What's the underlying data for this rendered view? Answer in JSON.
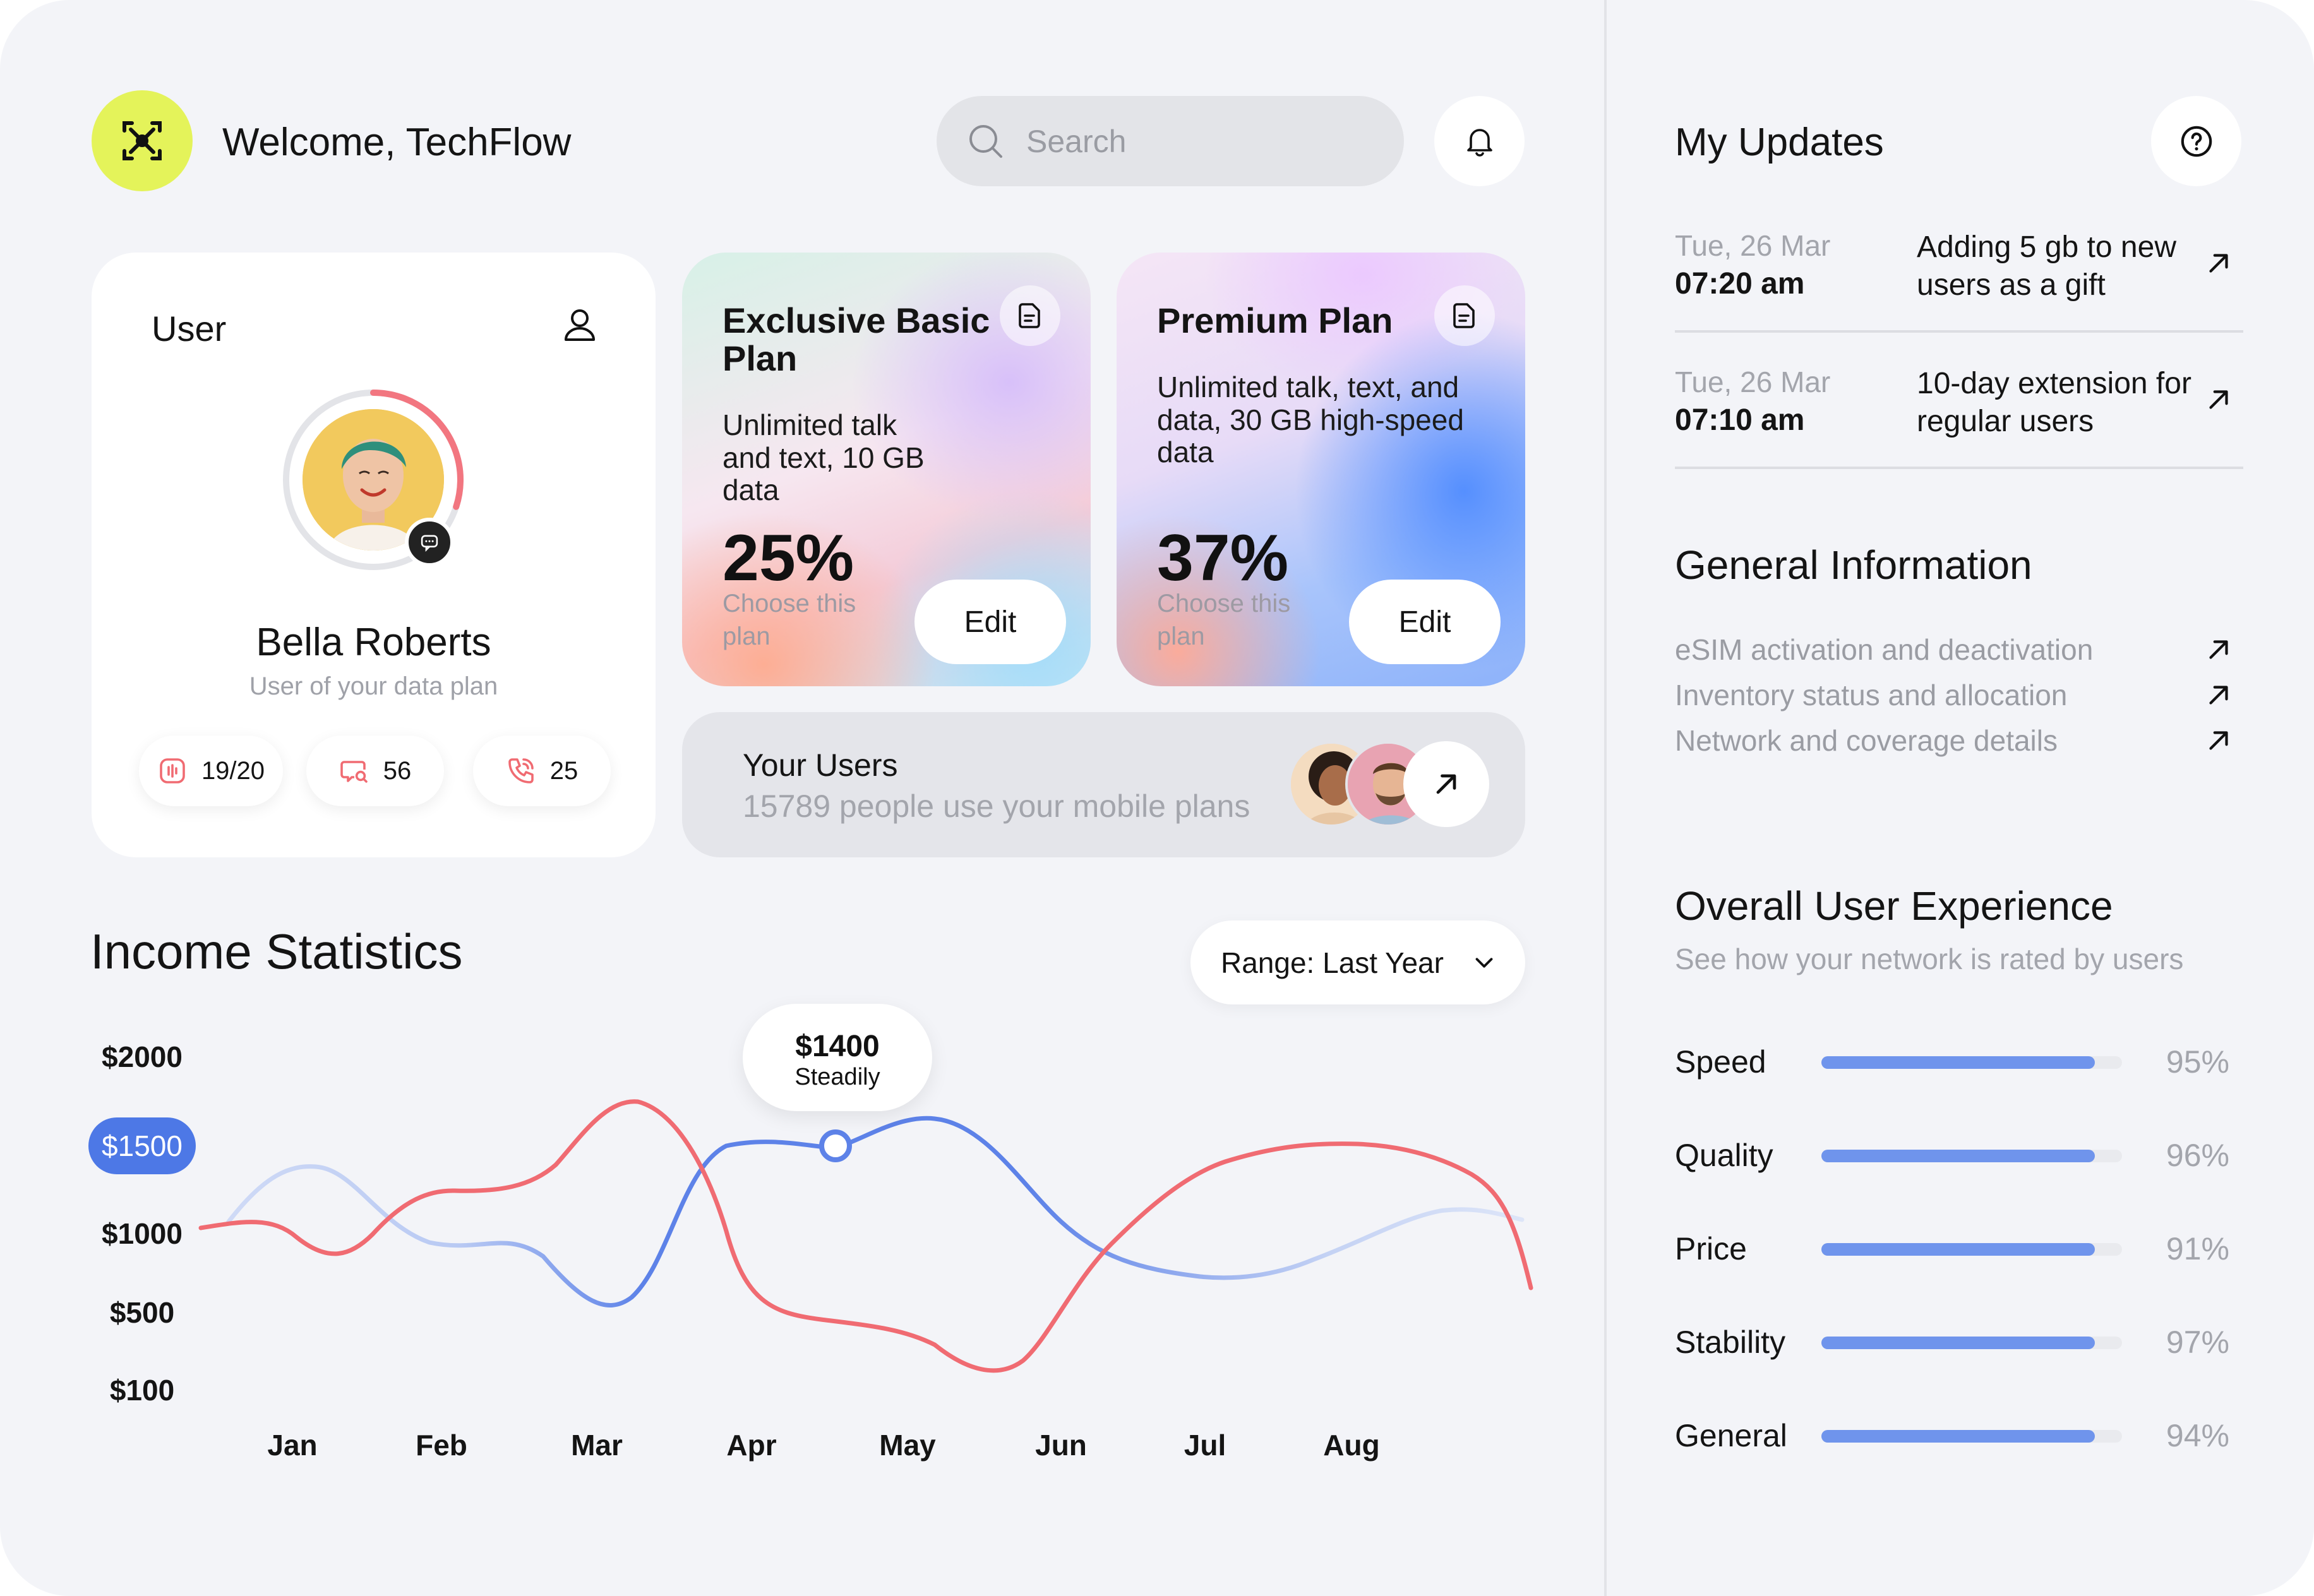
{
  "header": {
    "welcome": "Welcome, TechFlow",
    "search_placeholder": "Search",
    "logo_icon": "logo-cross-icon",
    "notification_icon": "bell-icon"
  },
  "user_card": {
    "title": "User",
    "name": "Bella Roberts",
    "role": "User of your data plan",
    "ring_progress": 0.3,
    "stats": [
      {
        "icon": "audio-wave-icon",
        "value": "19/20"
      },
      {
        "icon": "message-search-icon",
        "value": "56"
      },
      {
        "icon": "phone-icon",
        "value": "25"
      }
    ]
  },
  "plans": [
    {
      "title": "Exclusive Basic Plan",
      "description": "Unlimited talk and text, 10 GB data",
      "percent": "25%",
      "choose_text": "Choose this plan",
      "edit_label": "Edit"
    },
    {
      "title": "Premium Plan",
      "description": "Unlimited talk, text, and data, 30 GB high-speed data",
      "percent": "37%",
      "choose_text": "Choose this plan",
      "edit_label": "Edit"
    }
  ],
  "your_users": {
    "title": "Your Users",
    "subtitle": "15789 people use your mobile plans"
  },
  "income": {
    "title": "Income Statistics",
    "range_label": "Range: Last Year",
    "tooltip_value": "$1400",
    "tooltip_label": "Steadily"
  },
  "chart_data": {
    "type": "line",
    "title": "Income Statistics",
    "y_ticks": [
      "$2000",
      "$1500",
      "$1000",
      "$500",
      "$100"
    ],
    "highlighted_tick": "$1500",
    "x": [
      "Jan",
      "Feb",
      "Mar",
      "Apr",
      "May",
      "Jun",
      "Jul",
      "Aug"
    ],
    "series": [
      {
        "color": "#f06b72",
        "values": [
          1000,
          850,
          1250,
          2000,
          600,
          400,
          300,
          1000,
          1600,
          1650,
          900
        ]
      },
      {
        "color": "#5d82e8",
        "values": [
          1300,
          950,
          600,
          1400,
          1500,
          1600,
          1100,
          900,
          1050,
          1150
        ]
      }
    ],
    "marker": {
      "x": "Apr",
      "y": 1400
    }
  },
  "updates": {
    "title": "My Updates",
    "items": [
      {
        "date": "Tue, 26 Mar",
        "time": "07:20 am",
        "text": "Adding 5 gb to new users as a gift"
      },
      {
        "date": "Tue, 26 Mar",
        "time": "07:10 am",
        "text": "10-day extension for regular users"
      }
    ]
  },
  "general_info": {
    "title": "General Information",
    "items": [
      "eSIM activation and deactivation",
      "Inventory status and allocation",
      "Network and coverage details"
    ]
  },
  "user_experience": {
    "title": "Overall User Experience",
    "subtitle": "See how your network is rated by users",
    "rows": [
      {
        "label": "Speed",
        "value": "95%",
        "fill": 0.91
      },
      {
        "label": "Quality",
        "value": "96%",
        "fill": 0.91
      },
      {
        "label": "Price",
        "value": "91%",
        "fill": 0.91
      },
      {
        "label": "Stability",
        "value": "97%",
        "fill": 0.91
      },
      {
        "label": "General",
        "value": "94%",
        "fill": 0.91
      }
    ],
    "bar_color": "#6f94ec"
  }
}
